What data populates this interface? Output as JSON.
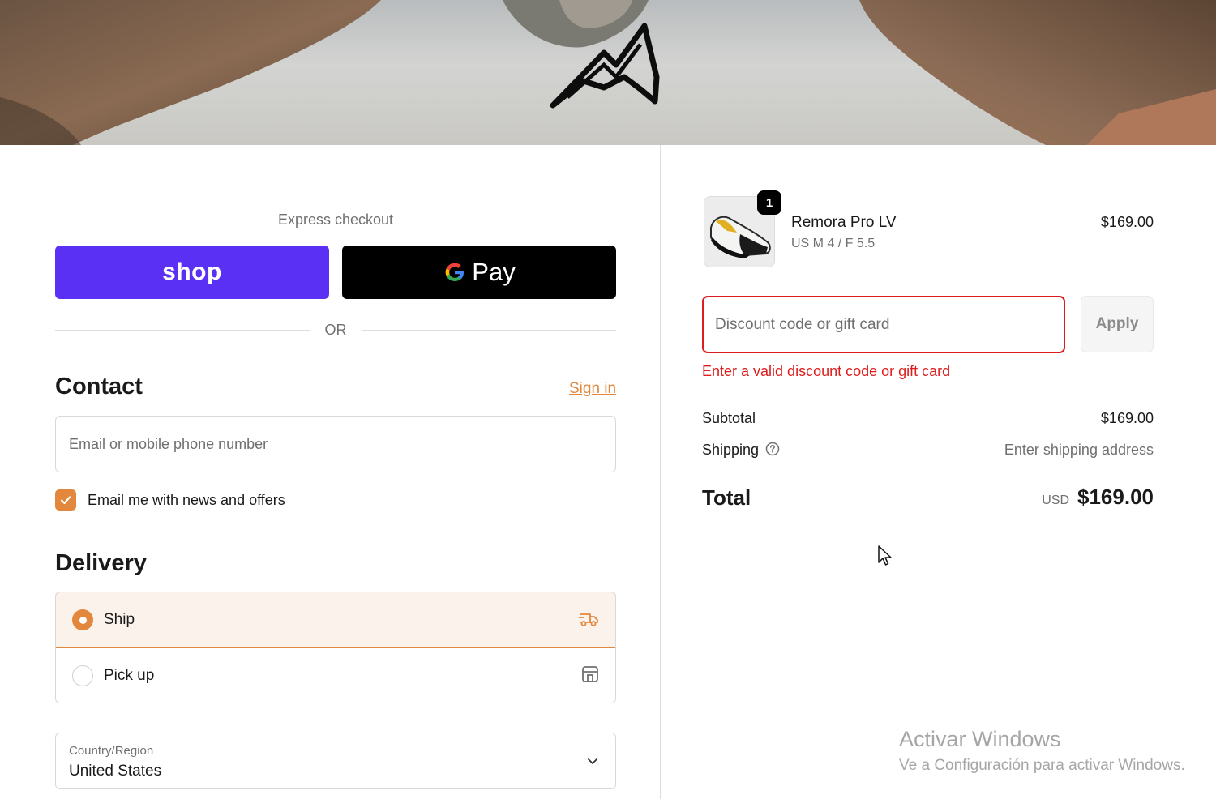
{
  "express": {
    "title": "Express checkout",
    "shop_label": "shop",
    "gpay_label": "Pay",
    "or_label": "OR"
  },
  "contact": {
    "heading": "Contact",
    "sign_in": "Sign in",
    "email_placeholder": "Email or mobile phone number",
    "newsletter_label": "Email me with news and offers",
    "newsletter_checked": true
  },
  "delivery": {
    "heading": "Delivery",
    "options": [
      {
        "label": "Ship",
        "selected": true,
        "icon": "truck-icon"
      },
      {
        "label": "Pick up",
        "selected": false,
        "icon": "store-icon"
      }
    ],
    "country": {
      "label": "Country/Region",
      "value": "United States"
    }
  },
  "cart": {
    "item": {
      "quantity": "1",
      "name": "Remora Pro LV",
      "variant": "US M 4 / F 5.5",
      "price": "$169.00"
    },
    "discount": {
      "placeholder": "Discount code or gift card",
      "apply_label": "Apply",
      "error": "Enter a valid discount code or gift card"
    },
    "summary": {
      "subtotal_label": "Subtotal",
      "subtotal_value": "$169.00",
      "shipping_label": "Shipping",
      "shipping_value": "Enter shipping address",
      "total_label": "Total",
      "currency": "USD",
      "total_value": "$169.00"
    }
  },
  "watermark": {
    "line1": "Activar Windows",
    "line2": "Ve a Configuración para activar Windows."
  },
  "colors": {
    "accent": "#e2873c",
    "shop_purple": "#5a31f4",
    "error": "#dd1d1d",
    "ship_bg": "#fcf2ec"
  }
}
